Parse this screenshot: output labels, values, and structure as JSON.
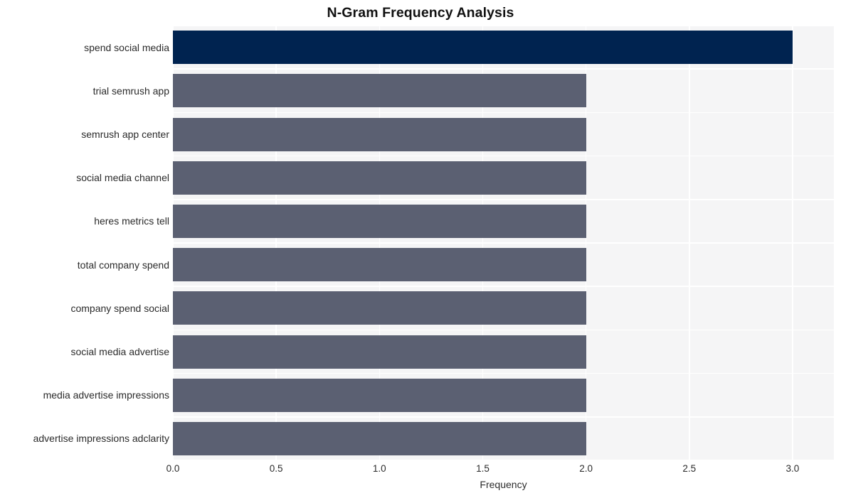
{
  "chart_data": {
    "type": "bar",
    "orientation": "horizontal",
    "title": "N-Gram Frequency Analysis",
    "xlabel": "Frequency",
    "ylabel": "",
    "categories": [
      "spend social media",
      "trial semrush app",
      "semrush app center",
      "social media channel",
      "heres metrics tell",
      "total company spend",
      "company spend social",
      "social media advertise",
      "media advertise impressions",
      "advertise impressions adclarity"
    ],
    "values": [
      3,
      2,
      2,
      2,
      2,
      2,
      2,
      2,
      2,
      2
    ],
    "bar_colors": [
      "#002350",
      "#5b6072",
      "#5b6072",
      "#5b6072",
      "#5b6072",
      "#5b6072",
      "#5b6072",
      "#5b6072",
      "#5b6072",
      "#5b6072"
    ],
    "xlim": [
      0,
      3.2
    ],
    "x_ticks": [
      0,
      0.5,
      1,
      1.5,
      2,
      2.5,
      3
    ],
    "x_tick_labels": [
      "0.0",
      "0.5",
      "1.0",
      "1.5",
      "2.0",
      "2.5",
      "3.0"
    ],
    "grid": true,
    "grid_color": "#ffffff",
    "plot_background": "#f5f5f6",
    "figure_background": "#ffffff",
    "legend": null,
    "highlight_color": "#002350",
    "base_color": "#5b6072"
  }
}
